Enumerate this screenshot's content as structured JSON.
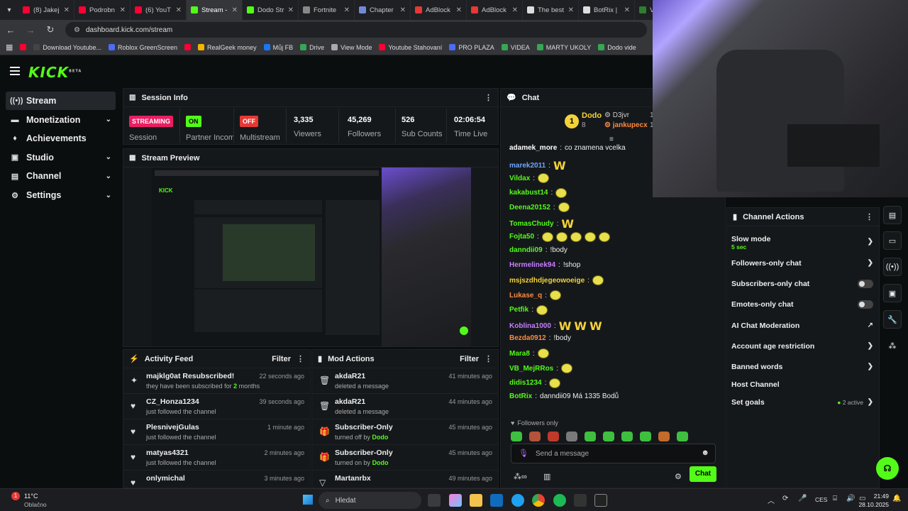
{
  "browser": {
    "tabs": [
      {
        "label": "(8) Jakej",
        "color": "#ff0033"
      },
      {
        "label": "Podrobn",
        "color": "#ff0033"
      },
      {
        "label": "(6) YouT",
        "color": "#ff0033"
      },
      {
        "label": "Stream -",
        "color": "#53fc18",
        "active": true
      },
      {
        "label": "Dodo Str",
        "color": "#53fc18"
      },
      {
        "label": "Fortnite",
        "color": "#888888"
      },
      {
        "label": "Chapter",
        "color": "#7289da"
      },
      {
        "label": "AdBlock",
        "color": "#e53935"
      },
      {
        "label": "AdBlock",
        "color": "#e53935"
      },
      {
        "label": "The best",
        "color": "#dddddd"
      },
      {
        "label": "BotRix |",
        "color": "#dddddd"
      },
      {
        "label": "V",
        "color": "#2e7d32"
      }
    ],
    "url": "dashboard.kick.com/stream",
    "bookmarks": [
      {
        "label": "",
        "color": "#ff0033"
      },
      {
        "label": "Download Youtube...",
        "color": "#444"
      },
      {
        "label": "Roblox GreenScreen",
        "color": "#4a6cf7"
      },
      {
        "label": "",
        "color": "#ff0033"
      },
      {
        "label": "RealGeek money",
        "color": "#f4b400"
      },
      {
        "label": "Můj FB",
        "color": "#1877f2"
      },
      {
        "label": "Drive",
        "color": "#34a853"
      },
      {
        "label": "View Mode",
        "color": "#aaa"
      },
      {
        "label": "Youtube Stahovaní",
        "color": "#ff0033"
      },
      {
        "label": "PRO PLAZA",
        "color": "#4a6cf7"
      },
      {
        "label": "VIDEA",
        "color": "#34a853"
      },
      {
        "label": "MARTY UKOLY",
        "color": "#34a853"
      },
      {
        "label": "Dodo vide",
        "color": "#34a853"
      }
    ]
  },
  "sidebar": {
    "logo": "KICK",
    "logo_sup": "BETA",
    "items": [
      {
        "label": "Stream",
        "icon": "((•))"
      },
      {
        "label": "Monetization",
        "icon": "▬"
      },
      {
        "label": "Achievements",
        "icon": "♦"
      },
      {
        "label": "Studio",
        "icon": "▣"
      },
      {
        "label": "Channel",
        "icon": "▤"
      },
      {
        "label": "Settings",
        "icon": "⚙"
      }
    ]
  },
  "session": {
    "title": "Session Info",
    "streaming_badge": "STREAMING",
    "streaming_label": "Session",
    "partner_badge": "ON",
    "partner_label": "Partner Income",
    "multistream_badge": "OFF",
    "multistream_label": "Multistream",
    "viewers": "3,335",
    "viewers_label": "Viewers",
    "followers": "45,269",
    "followers_label": "Followers",
    "subs": "526",
    "subs_label": "Sub Counts",
    "time": "02:06:54",
    "time_label": "Time Live"
  },
  "preview": {
    "title": "Stream Preview"
  },
  "activity": {
    "title": "Activity Feed",
    "filter": "Filter",
    "rows": [
      {
        "name": "majklg0at Resubscribed!",
        "sub": "they have been subscribed for",
        "highlight": "2",
        "sub_end": "months",
        "time": "22 seconds ago",
        "icon": "✦"
      },
      {
        "name": "CZ_Honza1234",
        "sub": "just followed the channel",
        "time": "39 seconds ago",
        "icon": "♥"
      },
      {
        "name": "PlesnivejGulas",
        "sub": "just followed the channel",
        "time": "1 minute ago",
        "icon": "♥"
      },
      {
        "name": "matyas4321",
        "sub": "just followed the channel",
        "time": "2 minutes ago",
        "icon": "♥"
      },
      {
        "name": "onlymichal",
        "sub": "",
        "time": "3 minutes ago",
        "icon": "♥"
      }
    ]
  },
  "mod_actions": {
    "title": "Mod Actions",
    "filter": "Filter",
    "rows": [
      {
        "name": "akdaR21",
        "sub": "deleted a message",
        "time": "41 minutes ago",
        "icon": "🗑"
      },
      {
        "name": "akdaR21",
        "sub": "deleted a message",
        "time": "44 minutes ago",
        "icon": "🗑"
      },
      {
        "name": "Subscriber-Only",
        "sub": "turned off by",
        "by": "Dodo",
        "time": "45 minutes ago",
        "icon": "🎁"
      },
      {
        "name": "Subscriber-Only",
        "sub": "turned on by",
        "by": "Dodo",
        "time": "45 minutes ago",
        "icon": "🎁"
      },
      {
        "name": "Martanrbx",
        "sub": "",
        "time": "49 minutes ago",
        "icon": "▽"
      }
    ]
  },
  "chat": {
    "title": "Chat",
    "top": [
      {
        "rank": "1",
        "name": "Dodo",
        "count": "8"
      },
      {
        "name": "D3jvr",
        "count": "1"
      },
      {
        "name": "jankupecx",
        "count": "1"
      }
    ],
    "messages": [
      {
        "user": "adamek_more",
        "color": "#ffffff",
        "text": "co znamena vcelka"
      },
      {
        "user": "marek2011",
        "color": "#6ea6ff",
        "emotes": [
          "W"
        ]
      },
      {
        "user": "Vildax",
        "color": "#53fc18",
        "emotes": [
          "face"
        ]
      },
      {
        "user": "kakabust14",
        "color": "#53fc18",
        "emotes": [
          "face"
        ]
      },
      {
        "user": "Deena20152",
        "color": "#53fc18",
        "emotes": [
          "face"
        ]
      },
      {
        "user": "TomasChudy",
        "color": "#53fc18",
        "emotes": [
          "W"
        ]
      },
      {
        "user": "Fojta50",
        "color": "#53fc18",
        "emotes": [
          "face",
          "face",
          "face",
          "face",
          "face"
        ]
      },
      {
        "user": "danndii09",
        "color": "#53fc18",
        "text": "!body"
      },
      {
        "user": "Hermelinek94",
        "color": "#c77dff",
        "text": "!shop"
      },
      {
        "user": "msjszdhdjegeowoeige",
        "color": "#f3d23a",
        "emotes": [
          "face"
        ]
      },
      {
        "user": "Lukase_q",
        "color": "#ff8a3d",
        "emotes": [
          "face"
        ]
      },
      {
        "user": "Petfik",
        "color": "#53fc18",
        "emotes": [
          "face"
        ]
      },
      {
        "user": "Koblina1000",
        "color": "#c77dff",
        "emotes": [
          "W",
          "W",
          "W"
        ]
      },
      {
        "user": "Bezda0912",
        "color": "#ff8a3d",
        "text": "!body"
      },
      {
        "user": "Mara8",
        "color": "#53fc18",
        "emotes": [
          "face"
        ]
      },
      {
        "user": "VB_MejRRos",
        "color": "#53fc18",
        "emotes": [
          "face"
        ]
      },
      {
        "user": "didis1234",
        "color": "#53fc18",
        "emotes": [
          "face"
        ]
      },
      {
        "user": "BotRix",
        "color": "#53fc18",
        "text": "danndii09 Má 1335 Bodů"
      }
    ],
    "followers_only": "Followers only",
    "placeholder": "Send a message",
    "send": "Chat"
  },
  "channel_actions": {
    "title": "Channel Actions",
    "slow_mode": "Slow mode",
    "slow_value": "5 sec",
    "followers_only": "Followers-only chat",
    "subscribers_only": "Subscribers-only chat",
    "emotes_only": "Emotes-only chat",
    "ai_moderation": "AI Chat Moderation",
    "account_age": "Account age restriction",
    "banned_words": "Banned words",
    "host": "Host Channel",
    "goals": "Set goals",
    "goals_active": "2 active"
  },
  "taskbar": {
    "weather_temp": "11°C",
    "weather_desc": "Oblačno",
    "search": "Hledat",
    "lang": "CES",
    "time": "21:49",
    "date": "28.10.2025"
  },
  "colors": {
    "accent": "#53fc18",
    "streaming": "#e91e63",
    "off": "#e53935"
  }
}
